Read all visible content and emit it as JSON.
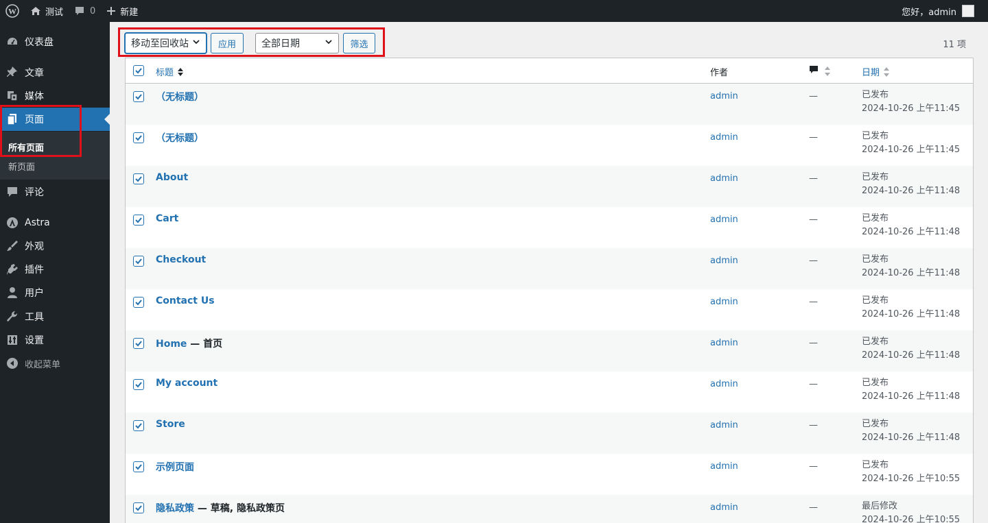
{
  "adminbar": {
    "site_name": "测试",
    "comments_count": "0",
    "new_label": "新建",
    "greeting": "您好，admin"
  },
  "sidebar": {
    "items": [
      {
        "label": "仪表盘",
        "icon": "dashboard-icon"
      },
      {
        "label": "文章",
        "icon": "pin-icon"
      },
      {
        "label": "媒体",
        "icon": "media-icon"
      },
      {
        "label": "页面",
        "icon": "pages-icon"
      },
      {
        "label": "评论",
        "icon": "comment-icon"
      },
      {
        "label": "Astra",
        "icon": "astra-icon"
      },
      {
        "label": "外观",
        "icon": "brush-icon"
      },
      {
        "label": "插件",
        "icon": "plugin-icon"
      },
      {
        "label": "用户",
        "icon": "user-icon"
      },
      {
        "label": "工具",
        "icon": "wrench-icon"
      },
      {
        "label": "设置",
        "icon": "settings-icon"
      }
    ],
    "submenu": [
      "所有页面",
      "新页面"
    ],
    "collapse_label": "收起菜单"
  },
  "toolbar": {
    "bulk_action": "移动至回收站",
    "apply_label": "应用",
    "date_filter": "全部日期",
    "filter_label": "筛选",
    "items_count": "11 项"
  },
  "table": {
    "columns": {
      "title": "标题",
      "author": "作者",
      "date": "日期"
    },
    "rows": [
      {
        "title": "（无标题）",
        "state": "",
        "author": "admin",
        "comments": "—",
        "status": "已发布",
        "date": "2024-10-26 上午11:45"
      },
      {
        "title": "（无标题）",
        "state": "",
        "author": "admin",
        "comments": "—",
        "status": "已发布",
        "date": "2024-10-26 上午11:45"
      },
      {
        "title": "About",
        "state": "",
        "author": "admin",
        "comments": "—",
        "status": "已发布",
        "date": "2024-10-26 上午11:48"
      },
      {
        "title": "Cart",
        "state": "",
        "author": "admin",
        "comments": "—",
        "status": "已发布",
        "date": "2024-10-26 上午11:48"
      },
      {
        "title": "Checkout",
        "state": "",
        "author": "admin",
        "comments": "—",
        "status": "已发布",
        "date": "2024-10-26 上午11:48"
      },
      {
        "title": "Contact Us",
        "state": "",
        "author": "admin",
        "comments": "—",
        "status": "已发布",
        "date": "2024-10-26 上午11:48"
      },
      {
        "title": "Home",
        "state": " — 首页",
        "author": "admin",
        "comments": "—",
        "status": "已发布",
        "date": "2024-10-26 上午11:48"
      },
      {
        "title": "My account",
        "state": "",
        "author": "admin",
        "comments": "—",
        "status": "已发布",
        "date": "2024-10-26 上午11:48"
      },
      {
        "title": "Store",
        "state": "",
        "author": "admin",
        "comments": "—",
        "status": "已发布",
        "date": "2024-10-26 上午11:48"
      },
      {
        "title": "示例页面",
        "state": "",
        "author": "admin",
        "comments": "—",
        "status": "已发布",
        "date": "2024-10-26 上午10:55"
      },
      {
        "title": "隐私政策",
        "state": " — 草稿, 隐私政策页",
        "author": "admin",
        "comments": "—",
        "status": "最后修改",
        "date": "2024-10-26 上午10:55"
      }
    ]
  },
  "colors": {
    "adminbar_bg": "#1d2327",
    "accent": "#2271b1",
    "highlight_box": "#e0101b"
  }
}
